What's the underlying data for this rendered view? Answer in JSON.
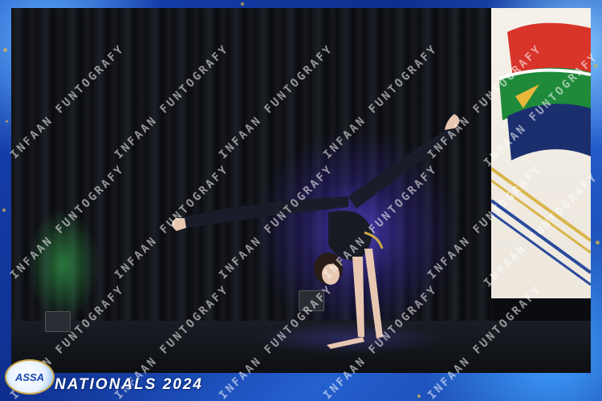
{
  "photo": {
    "subject": "gymnast-handstand-split",
    "accent_colors": {
      "frame_blue": "#1846b8",
      "frame_gold": "#d9b54a",
      "stage_light_purple": "#5a46e6",
      "banner_red": "#d8342a",
      "banner_green": "#1f8a3a",
      "banner_navy": "#1b2f6e"
    }
  },
  "watermark": {
    "text": "INFAAN FUNTOGRAFY"
  },
  "logo": {
    "text": "ASSA"
  },
  "event": {
    "title": "NATIONALS 2024"
  }
}
